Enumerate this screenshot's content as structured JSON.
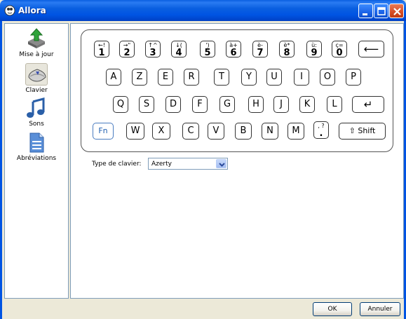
{
  "window": {
    "title": "Allora"
  },
  "sidebar": {
    "items": [
      {
        "label": "Mise à jour",
        "icon": "update-icon"
      },
      {
        "label": "Clavier",
        "icon": "keyboard-icon",
        "selected": true
      },
      {
        "label": "Sons",
        "icon": "music-note-icon"
      },
      {
        "label": "Abréviations",
        "icon": "document-icon"
      }
    ]
  },
  "keyboard": {
    "row1": [
      {
        "top": "←!",
        "bottom": "1"
      },
      {
        "top": "→\"",
        "bottom": "2"
      },
      {
        "top": "↑^",
        "bottom": "3"
      },
      {
        "top": "↓(",
        "bottom": "4"
      },
      {
        "top": "')",
        "bottom": "5"
      },
      {
        "top": "à+",
        "bottom": "6"
      },
      {
        "top": "è-",
        "bottom": "7"
      },
      {
        "top": "è*",
        "bottom": "8"
      },
      {
        "top": "ù:",
        "bottom": "9"
      },
      {
        "top": "ç=",
        "bottom": "0"
      }
    ],
    "backspace": "⟵",
    "row2": [
      "A",
      "Z",
      "E",
      "R",
      "T",
      "Y",
      "U",
      "I",
      "O",
      "P"
    ],
    "row3": [
      "Q",
      "S",
      "D",
      "F",
      "G",
      "H",
      "J",
      "K",
      "L"
    ],
    "enter": "↵",
    "fn": "Fn",
    "row4": [
      "W",
      "X",
      "C",
      "V",
      "B",
      "N",
      "M"
    ],
    "punct": {
      "top": ", ?",
      "bottom": "."
    },
    "shift": "⇧ Shift"
  },
  "keyboard_type": {
    "label": "Type de clavier:",
    "value": "Azerty"
  },
  "buttons": {
    "ok": "OK",
    "cancel": "Annuler"
  }
}
